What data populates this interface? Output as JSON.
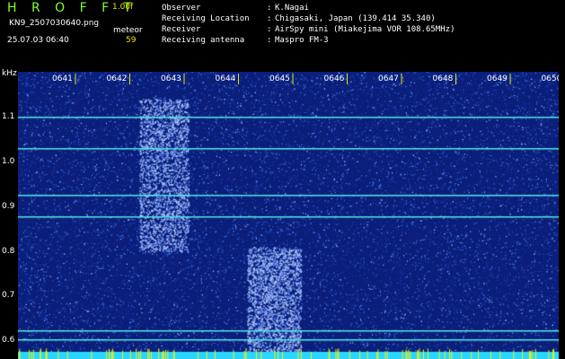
{
  "app": {
    "brand": "H R O F F T",
    "version": "1.00f",
    "filename": "KN9_2507030640.png",
    "mode": "meteor",
    "timestamp": "25.07.03 06:40",
    "count": "59"
  },
  "info": [
    {
      "key": "Observer",
      "value": "K.Nagai"
    },
    {
      "key": "Receiving Location",
      "value": "Chigasaki, Japan (139.414 35.340)"
    },
    {
      "key": "Receiver",
      "value": "AirSpy mini (Miakejima VOR 108.65MHz)"
    },
    {
      "key": "Receiving antenna",
      "value": "Maspro FM-3"
    }
  ],
  "info_separator": ":",
  "chart_data": {
    "type": "heatmap",
    "ylabel": "kHz",
    "yticks": [
      "1.1",
      "1.0",
      "0.9",
      "0.8",
      "0.7",
      "0.6"
    ],
    "xticks": [
      "0641",
      "0642",
      "0643",
      "0644",
      "0645",
      "0646",
      "0647",
      "0648",
      "0649",
      "0650"
    ],
    "horizontal_lines_khz": [
      1.1,
      1.03,
      0.925,
      0.875,
      0.62,
      0.6
    ],
    "colors": {
      "background": "#0a1e7a",
      "noise": "#3f6fe0",
      "line": "#55e7e0",
      "tick_marks": "#e8e800",
      "bottom_band": "#29d6ff"
    }
  }
}
